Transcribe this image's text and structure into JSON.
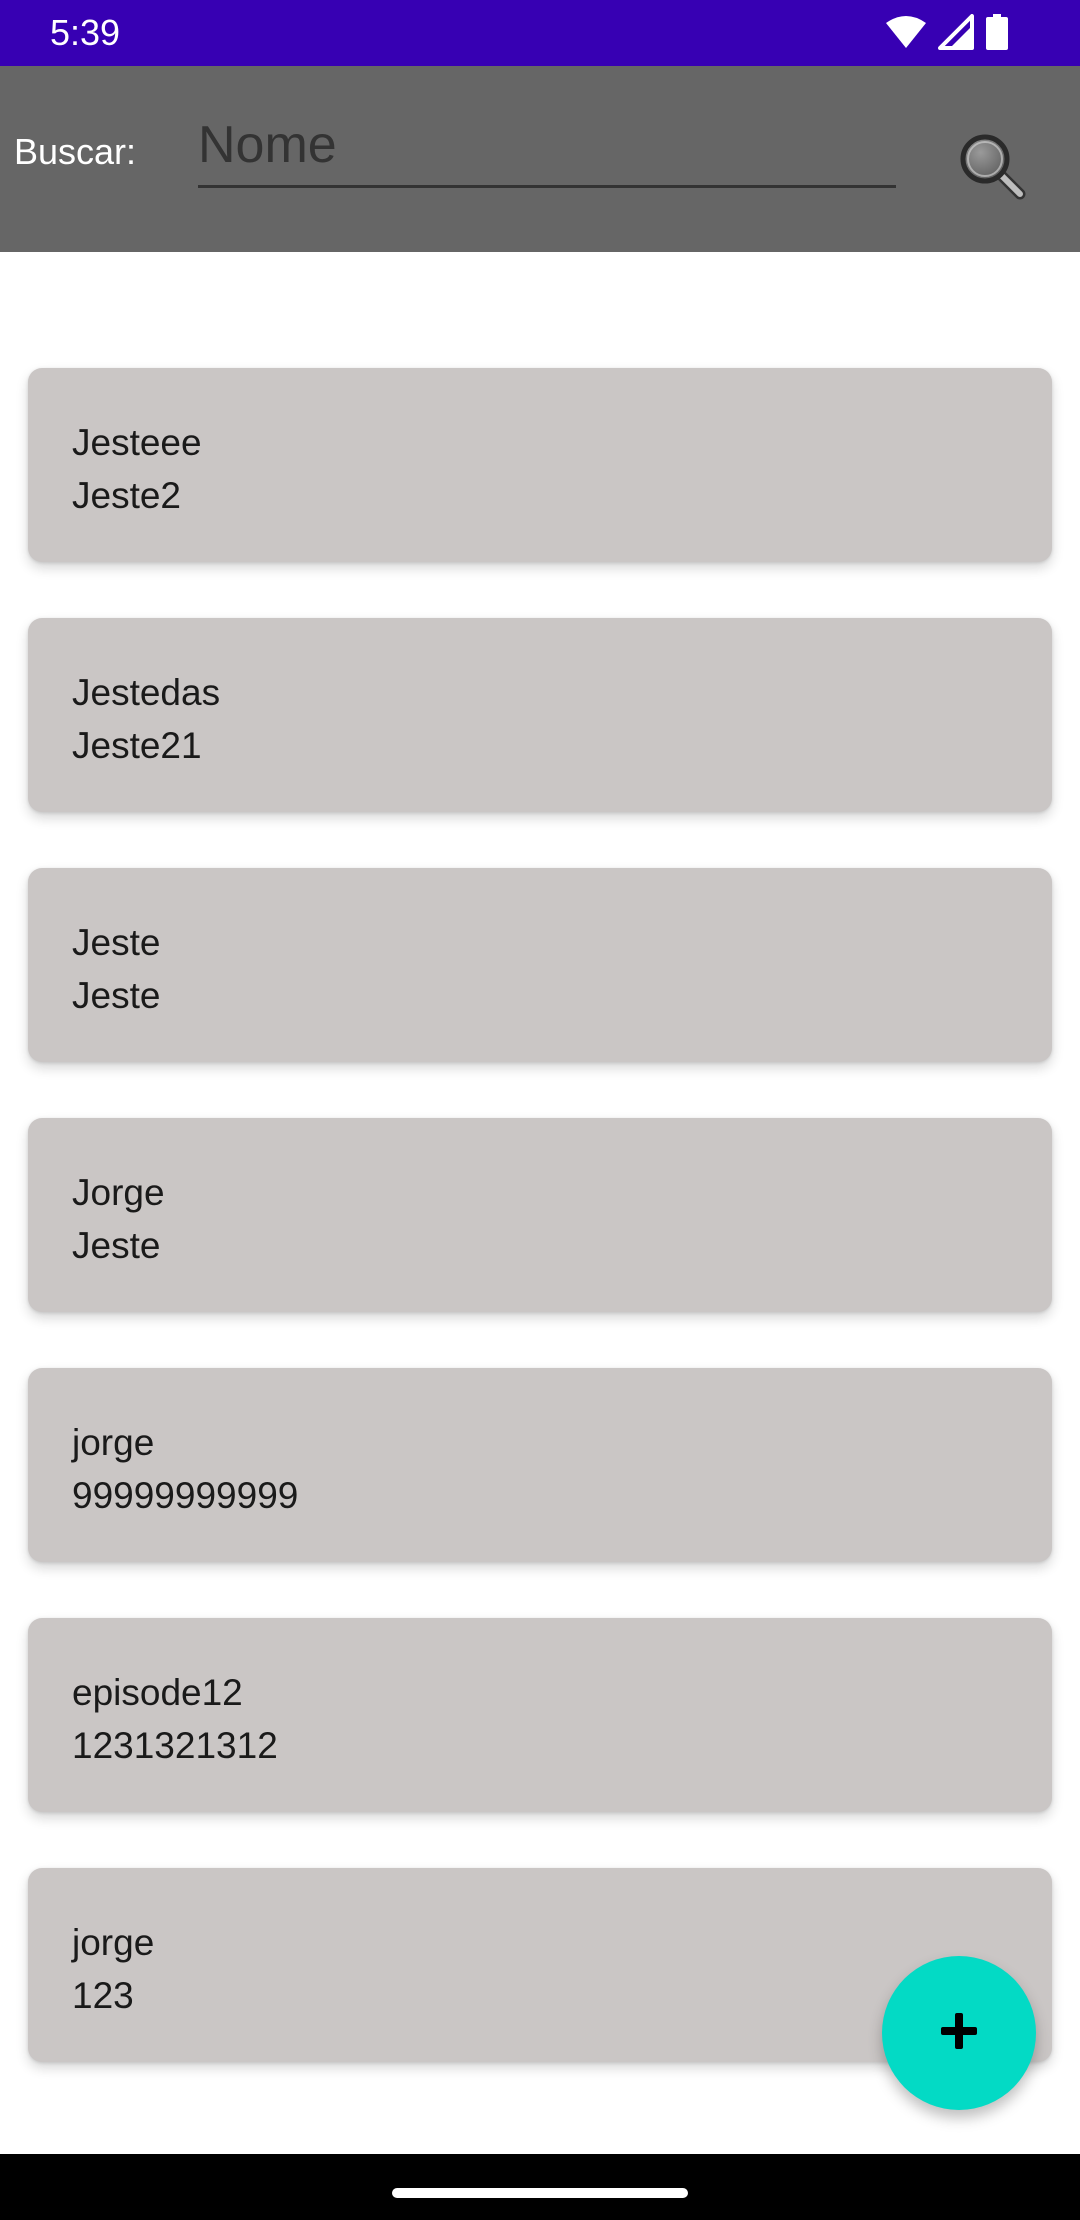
{
  "status_bar": {
    "time": "5:39",
    "icons": [
      "wifi-icon",
      "cellular-signal-icon",
      "battery-icon"
    ],
    "background": "#3700b3"
  },
  "toolbar": {
    "search_label": "Buscar:",
    "search_placeholder": "Nome",
    "search_value": "",
    "search_button_icon": "magnifier-icon",
    "background": "#666666"
  },
  "contacts": [
    {
      "name": "Jesteee",
      "phone": "Jeste2"
    },
    {
      "name": "Jestedas",
      "phone": "Jeste21"
    },
    {
      "name": "Jeste",
      "phone": "Jeste"
    },
    {
      "name": "Jorge",
      "phone": "Jeste"
    },
    {
      "name": "jorge",
      "phone": "99999999999"
    },
    {
      "name": "episode12",
      "phone": "1231321312"
    },
    {
      "name": "jorge",
      "phone": "123"
    }
  ],
  "fab": {
    "icon": "plus-icon",
    "color": "#03dac5"
  },
  "colors": {
    "card_background": "#cac6c5",
    "text": "#1a1a1a"
  }
}
